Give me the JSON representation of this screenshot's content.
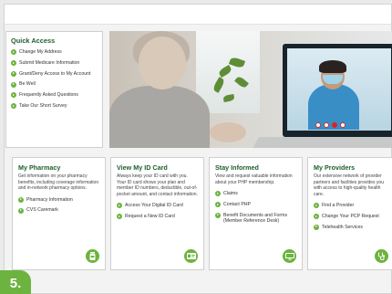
{
  "quick_access": {
    "title": "Quick Access",
    "items": [
      "Change My Address",
      "Submit Medicare Information",
      "Grant/Deny Access to My Account",
      "Be Well",
      "Frequently Asked Questions",
      "Take Our Short Survey"
    ]
  },
  "cards": [
    {
      "title": "My Pharmacy",
      "description": "Get information on your pharmacy benefits, including coverage information and in-network pharmacy options.",
      "links": [
        "Pharmacy Information",
        "CVS Caremark"
      ],
      "icon": "pill-bottle-icon"
    },
    {
      "title": "View My ID Card",
      "description": "Always keep your ID card with you. Your ID card shows your plan and member ID numbers, deductible, out-of-pocket amount, and contact information.",
      "links": [
        "Access Your Digital ID Card",
        "Request a New ID Card"
      ],
      "icon": "id-card-icon"
    },
    {
      "title": "Stay Informed",
      "description": "View and request valuable information about your PHP membership.",
      "links": [
        "Claims",
        "Contact PHP",
        "Benefit Documents and Forms (Member Reference Desk)"
      ],
      "icon": "monitor-icon"
    },
    {
      "title": "My Providers",
      "description": "Our extensive network of provider partners and facilities provides you with access to high-quality health care.",
      "links": [
        "Find a Provider",
        "Change Your PCP Request",
        "Telehealth Services"
      ],
      "icon": "stethoscope-icon"
    }
  ],
  "step_badge": "5.",
  "colors": {
    "brand_green": "#6cb33f",
    "title_green": "#1e5e2c"
  }
}
